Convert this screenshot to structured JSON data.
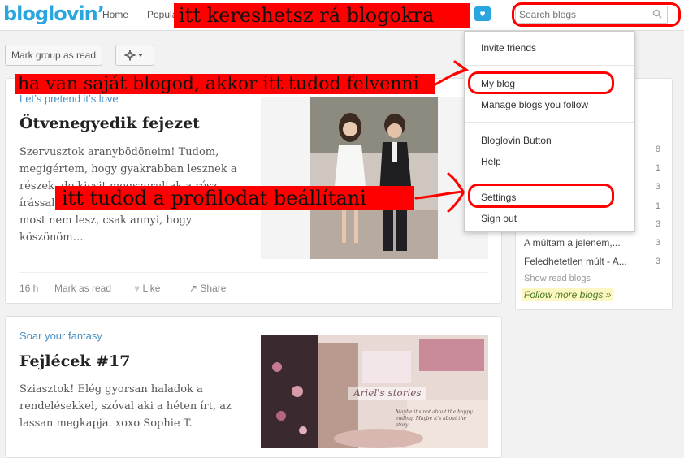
{
  "header": {
    "logo": "bloglovin’",
    "nav": {
      "home": "Home",
      "popular": "Popula"
    },
    "search": {
      "placeholder": "Search blogs"
    }
  },
  "toolbar": {
    "mark_group_label": "Mark group as read"
  },
  "posts": [
    {
      "blog": "Let’s pretend it’s love",
      "title": "Ötvenegyedik fejezet",
      "excerpt": "Szervusztok aranybödöneim! Tudom, megígértem, hogy gyakrabban lesznek a részek, de kicsit megszorultak a rész írással, most sem olvasd, most s duma most nem lesz, csak annyi, hogy köszönöm…",
      "time": "16 h",
      "mark_read": "Mark as read",
      "like": "Like",
      "share": "Share"
    },
    {
      "blog": "Soar your fantasy",
      "title": "Fejlécek #17",
      "excerpt": "Sziasztok! Elég gyorsan haladok a rendelésekkel, szóval aki a héten írt, az lassan megkapja. xoxo Sophie T.",
      "thumb_text": "Ariel's stories",
      "thumb_caption": "Maybe it's not about the happy ending. Maybe it's about the story."
    }
  ],
  "sidebar": {
    "rows": [
      {
        "label": "s",
        "count": ""
      },
      {
        "label": "ving",
        "count": "8"
      },
      {
        "label": "Be...",
        "count": "1"
      },
      {
        "label": "t's love",
        "count": "3"
      },
      {
        "label": "- Sa...",
        "count": "1"
      },
      {
        "label": "asy",
        "count": "3"
      },
      {
        "label": "A múltam a jelenem,...",
        "count": "3"
      },
      {
        "label": "Feledhetetlen múlt - A...",
        "count": "3"
      }
    ],
    "show_read": "Show read blogs",
    "follow_more": "Follow more blogs »"
  },
  "dropdown": {
    "items": [
      "Invite friends",
      "My blog",
      "Manage blogs you follow",
      "Bloglovin Button",
      "Help",
      "Settings",
      "Sign out"
    ]
  },
  "annotations": {
    "search": "itt kereshetsz rá blogokra",
    "myblog": "ha van saját blogod, akkor itt tudod felvenni",
    "settings": "itt tudod a profilodat beállítani"
  },
  "colors": {
    "brand": "#29a6e0",
    "annotation": "#ff0000",
    "link": "#4a90c2"
  }
}
